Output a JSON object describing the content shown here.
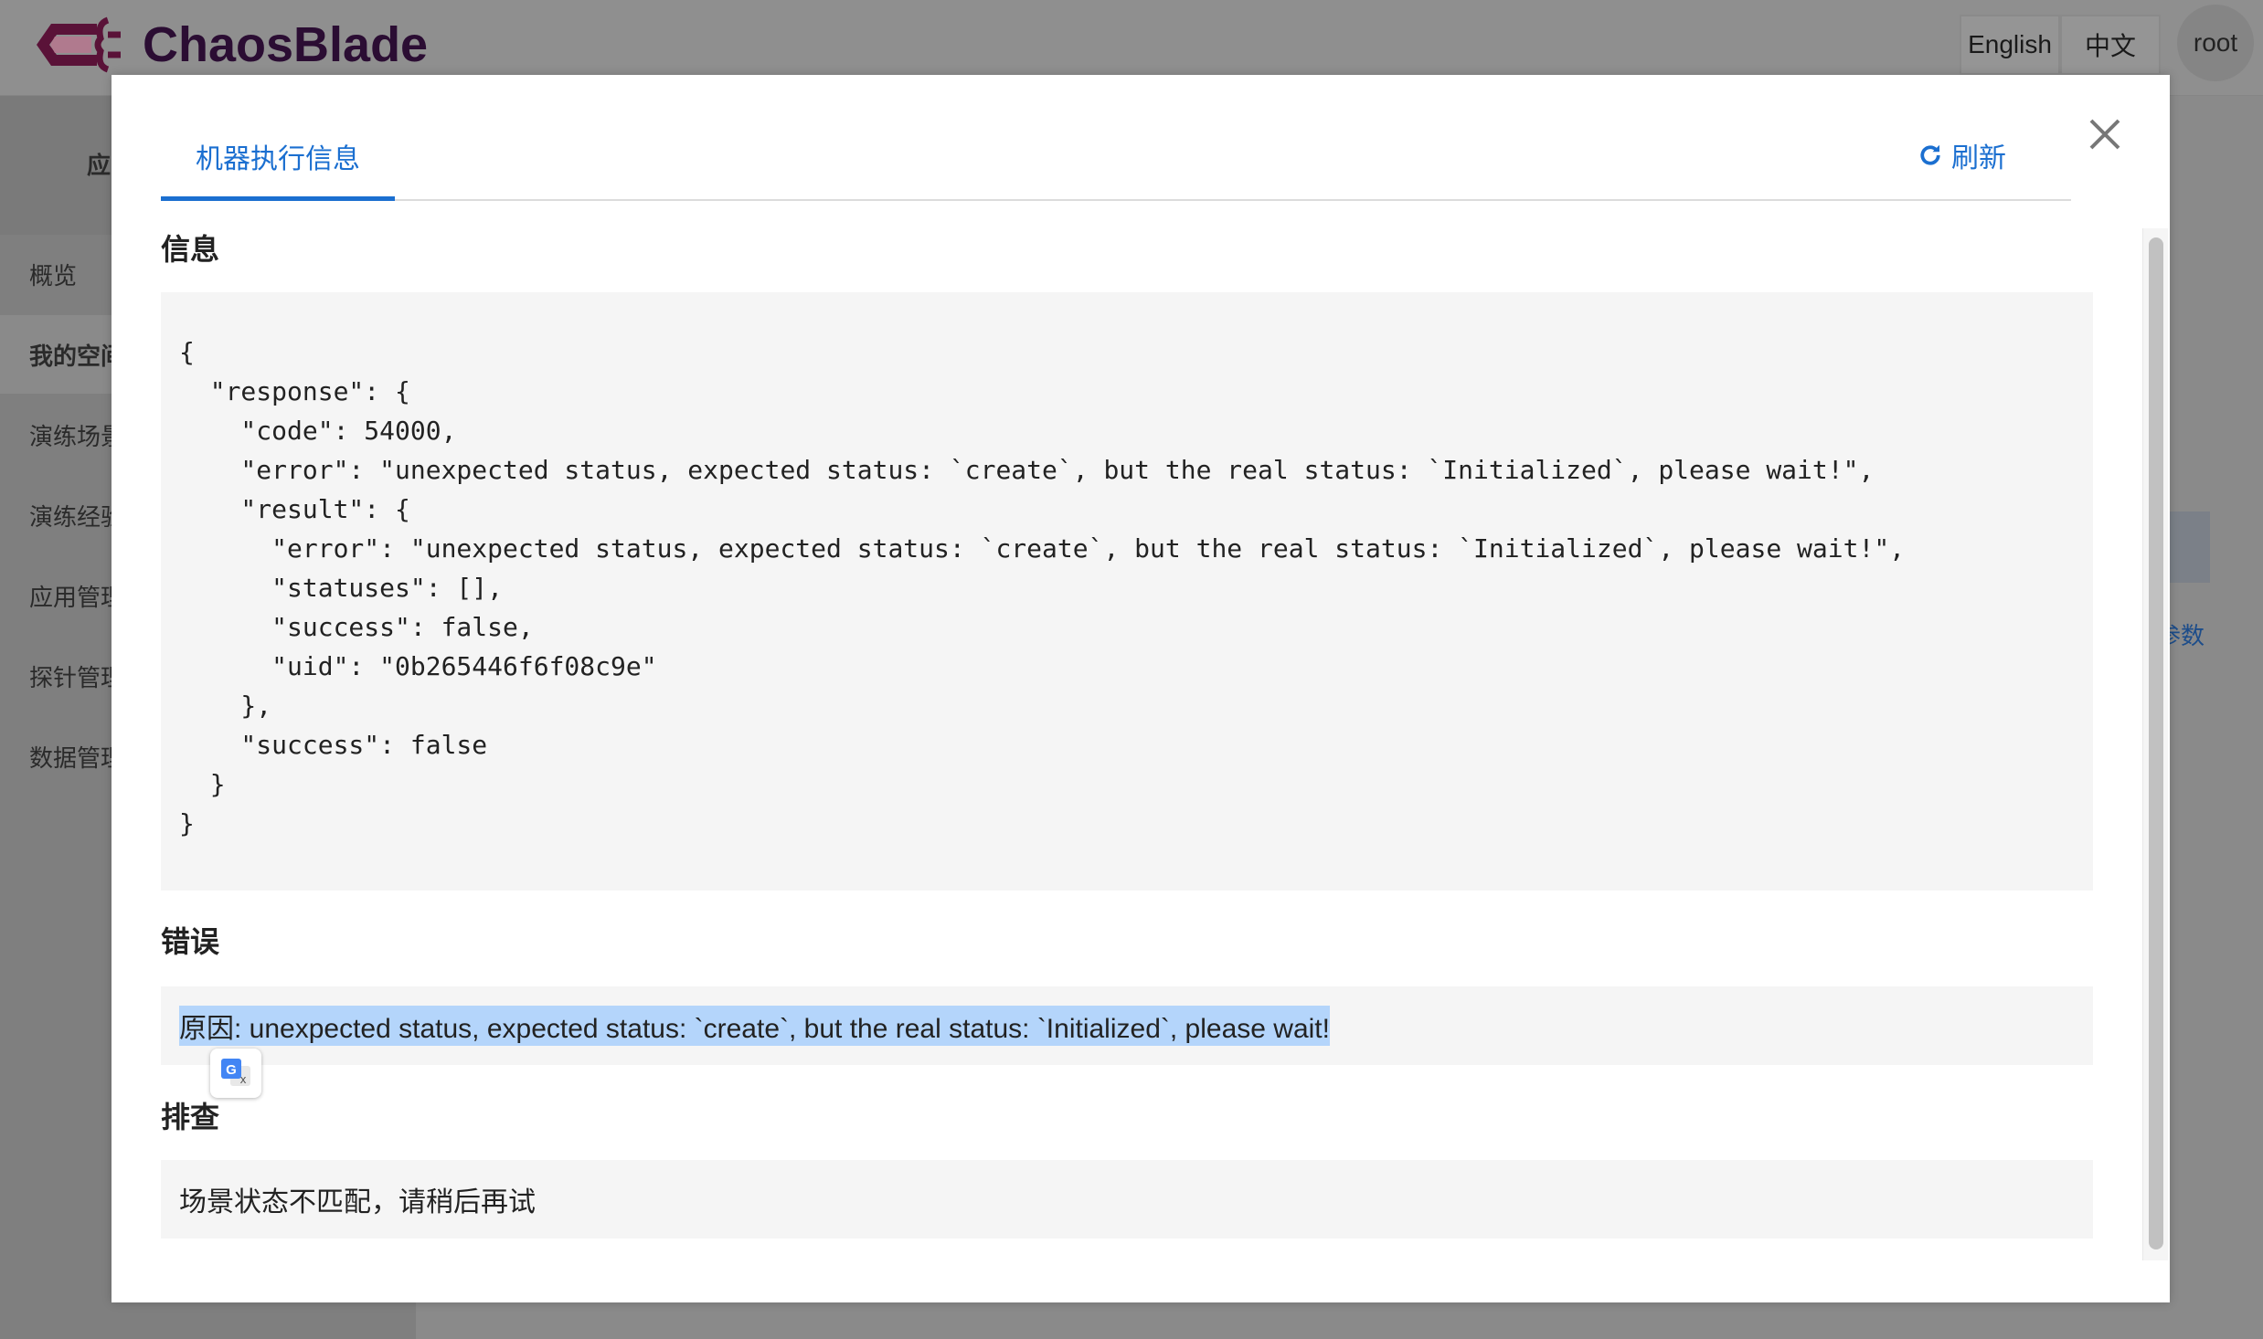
{
  "header": {
    "brand": "ChaosBlade",
    "lang_english": "English",
    "lang_chinese": "中文",
    "user": "root"
  },
  "sidebar": {
    "top_label": "应",
    "items": [
      {
        "label": "概览"
      },
      {
        "label": "我的空间",
        "selected": true
      },
      {
        "label": "演练场景"
      },
      {
        "label": "演练经验"
      },
      {
        "label": "应用管理"
      },
      {
        "label": "探针管理"
      },
      {
        "label": "数据管理"
      }
    ]
  },
  "background": {
    "right_link": "参数"
  },
  "modal": {
    "tab": "机器执行信息",
    "refresh_label": "刷新",
    "info_heading": "信息",
    "info_json": "{\n  \"response\": {\n    \"code\": 54000,\n    \"error\": \"unexpected status, expected status: `create`, but the real status: `Initialized`, please wait!\",\n    \"result\": {\n      \"error\": \"unexpected status, expected status: `create`, but the real status: `Initialized`, please wait!\",\n      \"statuses\": [],\n      \"success\": false,\n      \"uid\": \"0b265446f6f08c9e\"\n    },\n    \"success\": false\n  }\n}",
    "error_heading": "错误",
    "error_text": "原因: unexpected status, expected status: `create`, but the real status: `Initialized`, please wait!",
    "troubleshoot_heading": "排查",
    "troubleshoot_text": "场景状态不匹配，请稍后再试"
  },
  "colors": {
    "accent": "#1b6fd0",
    "selection": "#b4d5fb",
    "brand": "#2b0d33"
  }
}
